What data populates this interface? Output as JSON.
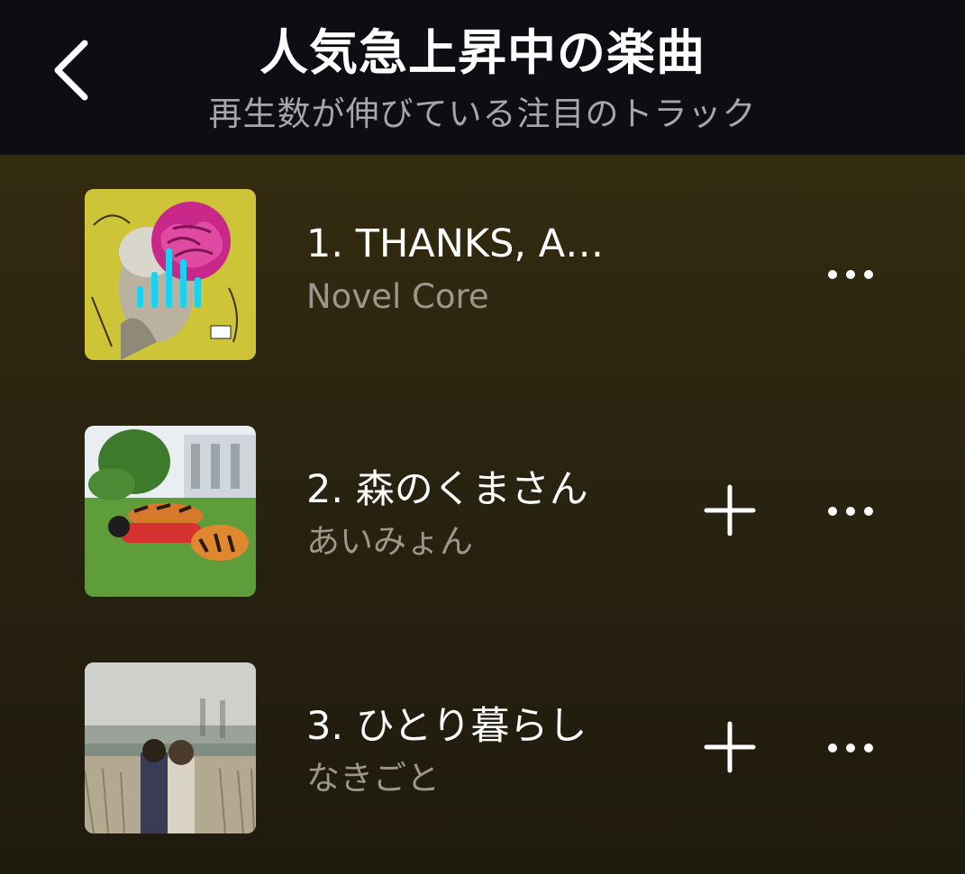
{
  "header": {
    "title": "人気急上昇中の楽曲",
    "subtitle": "再生数が伸びている注目のトラック",
    "back_icon": "chevron-left-icon"
  },
  "colors": {
    "header_bg": "#0d0e13",
    "body_bg_top": "#393010",
    "body_bg_bottom": "#1e1a0e",
    "title_text": "#ffffff",
    "subtitle_text": "#a7a7ab",
    "artist_text": "#9b978c",
    "playing_indicator": "#1ad1f0"
  },
  "tracks": [
    {
      "title": "1. THANKS, A…",
      "artist": "Novel Core",
      "now_playing": true,
      "show_add_button": false,
      "cover_icon": "album-cover-brain-art",
      "more_icon": "more-horizontal-icon"
    },
    {
      "title": "2. 森のくまさん",
      "artist": "あいみょん",
      "now_playing": false,
      "show_add_button": true,
      "cover_icon": "album-cover-tiger-lawn",
      "add_icon": "plus-icon",
      "more_icon": "more-horizontal-icon"
    },
    {
      "title": "3. ひとり暮らし",
      "artist": "なきごと",
      "now_playing": false,
      "show_add_button": true,
      "cover_icon": "album-cover-riverbank-duo",
      "add_icon": "plus-icon",
      "more_icon": "more-horizontal-icon"
    }
  ]
}
